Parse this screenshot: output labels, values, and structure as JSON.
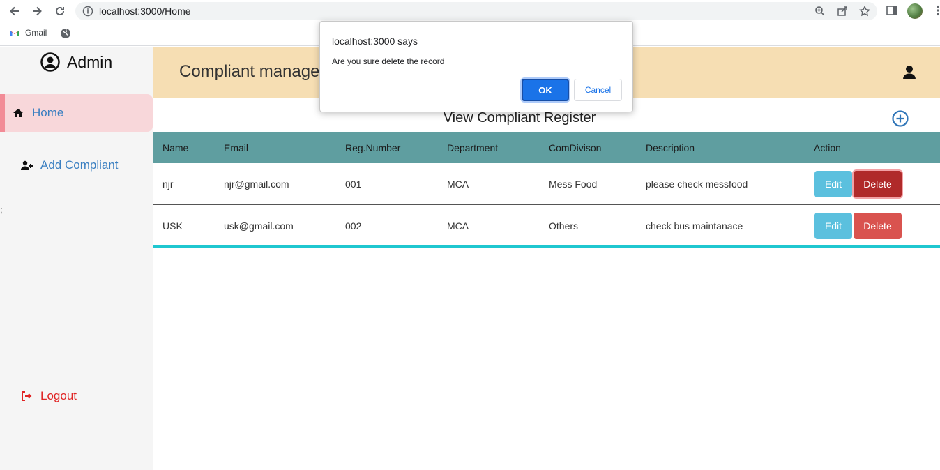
{
  "browser": {
    "url": "localhost:3000/Home",
    "bookmarks": [
      {
        "label": "Gmail"
      }
    ]
  },
  "sidebar": {
    "brand": "Admin",
    "items": [
      {
        "label": "Home",
        "icon": "home-icon",
        "active": true
      },
      {
        "label": "Add Compliant",
        "icon": "user-plus-icon"
      }
    ],
    "stray_text": ";",
    "logout_label": "Logout"
  },
  "header": {
    "title": "Compliant management"
  },
  "main": {
    "page_title": "View Compliant Register",
    "table": {
      "columns": [
        "Name",
        "Email",
        "Reg.Number",
        "Department",
        "ComDivison",
        "Description",
        "Action"
      ],
      "rows": [
        {
          "name": "njr",
          "email": "njr@gmail.com",
          "reg": "001",
          "department": "MCA",
          "division": "Mess Food",
          "description": "please check messfood"
        },
        {
          "name": "USK",
          "email": "usk@gmail.com",
          "reg": "002",
          "department": "MCA",
          "division": "Others",
          "description": "check bus maintanace"
        }
      ],
      "edit_label": "Edit",
      "delete_label": "Delete"
    }
  },
  "dialog": {
    "title": "localhost:3000 says",
    "message": "Are you sure delete the record",
    "ok_label": "OK",
    "cancel_label": "Cancel"
  },
  "colors": {
    "header_bg": "#f6deb3",
    "table_head_bg": "#5f9ea0",
    "active_nav_bg": "#f8d7da",
    "link_blue": "#3a7fc1",
    "logout_red": "#e02424"
  }
}
